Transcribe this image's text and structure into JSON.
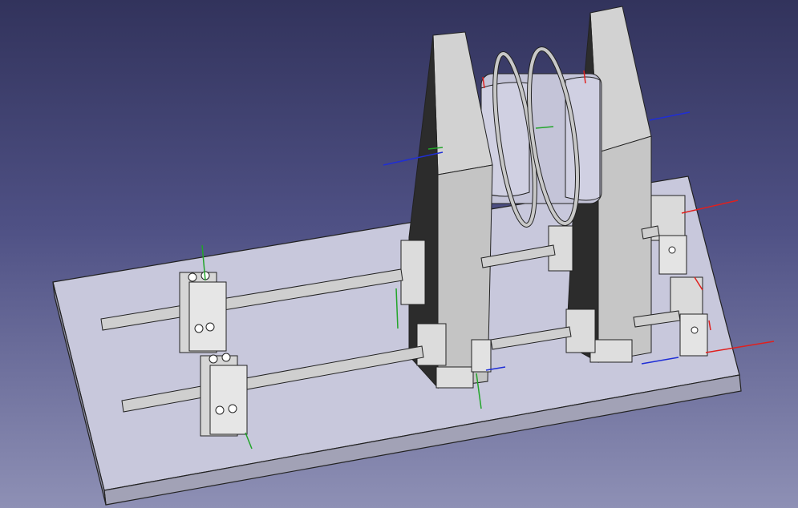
{
  "app": {
    "name": "3D CAD viewport",
    "view_mode": "axonometric"
  },
  "colors": {
    "background_top": "#32335c",
    "background_bottom": "#8e90b5",
    "base_plate_top": "#c8c8dc",
    "base_plate_side": "#a2a2b6",
    "upright_front": "#2c2c2c",
    "upright_edge": "#cacaca",
    "drum": "#c4c4d8",
    "rod": "#cfcfcf",
    "block": "#d6d6d6",
    "axis_x": "#e0201e",
    "axis_y": "#22a52a",
    "axis_z": "#1f2ed6"
  },
  "model": {
    "parts": [
      "base-plate",
      "left-upright-plate",
      "right-upright-plate",
      "cable-drum",
      "guide-rod-upper",
      "guide-rod-lower",
      "rod-clamp-block"
    ]
  }
}
